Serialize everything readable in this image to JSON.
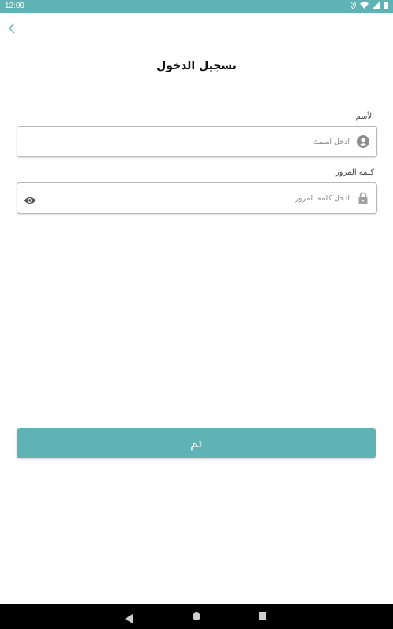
{
  "status_bar": {
    "time": "12:09"
  },
  "header": {
    "title": "تسجيل الدخول"
  },
  "form": {
    "name_label": "الأسم",
    "name_placeholder": "ادخل اسمك",
    "password_label": "كلمة المرور",
    "password_placeholder": "ادخل كلمة المرور"
  },
  "submit": {
    "label": "تم"
  },
  "colors": {
    "accent": "#5fb3b4"
  },
  "icons": {
    "back": "chevron-left-icon",
    "name_field": "user-circle-icon",
    "password_field": "lock-icon",
    "password_toggle": "eye-icon"
  }
}
